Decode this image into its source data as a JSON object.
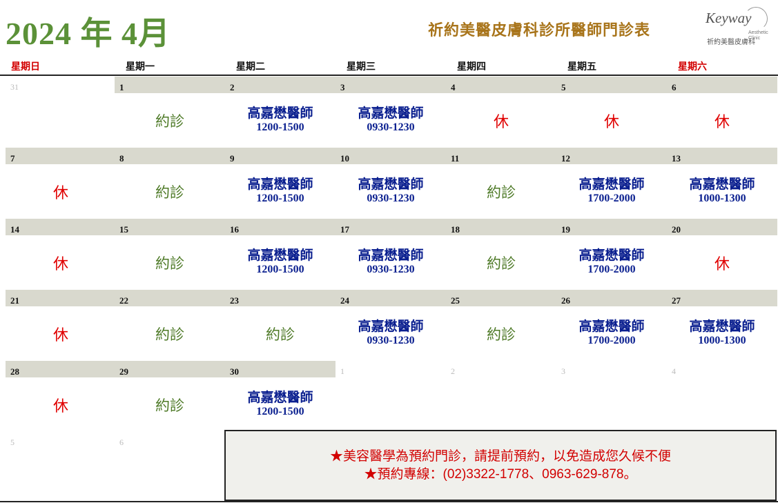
{
  "header": {
    "month_title": "2024 年 4月",
    "clinic_title": "祈約美醫皮膚科診所醫師門診表",
    "logo_script": "Keyway",
    "logo_sub": "祈約美醫皮膚科",
    "logo_aesthetic": "Aesthetic",
    "logo_clinic": "Clinic"
  },
  "weekdays": [
    {
      "label": "星期日",
      "color": "#d20000"
    },
    {
      "label": "星期一",
      "color": "#111111"
    },
    {
      "label": "星期二",
      "color": "#111111"
    },
    {
      "label": "星期三",
      "color": "#111111"
    },
    {
      "label": "星期四",
      "color": "#111111"
    },
    {
      "label": "星期五",
      "color": "#111111"
    },
    {
      "label": "星期六",
      "color": "#d20000"
    }
  ],
  "weeks": [
    [
      {
        "day": "31",
        "other": true
      },
      {
        "day": "1",
        "type": "appt",
        "text": "約診"
      },
      {
        "day": "2",
        "type": "doctor",
        "doctor": "高嘉懋醫師",
        "time": "1200-1500"
      },
      {
        "day": "3",
        "type": "doctor",
        "doctor": "高嘉懋醫師",
        "time": "0930-1230"
      },
      {
        "day": "4",
        "type": "rest",
        "text": "休"
      },
      {
        "day": "5",
        "type": "rest",
        "text": "休"
      },
      {
        "day": "6",
        "type": "rest",
        "text": "休"
      }
    ],
    [
      {
        "day": "7",
        "type": "rest",
        "text": "休"
      },
      {
        "day": "8",
        "type": "appt",
        "text": "約診"
      },
      {
        "day": "9",
        "type": "doctor",
        "doctor": "高嘉懋醫師",
        "time": "1200-1500"
      },
      {
        "day": "10",
        "type": "doctor",
        "doctor": "高嘉懋醫師",
        "time": "0930-1230"
      },
      {
        "day": "11",
        "type": "appt",
        "text": "約診"
      },
      {
        "day": "12",
        "type": "doctor",
        "doctor": "高嘉懋醫師",
        "time": "1700-2000"
      },
      {
        "day": "13",
        "type": "doctor",
        "doctor": "高嘉懋醫師",
        "time": "1000-1300"
      }
    ],
    [
      {
        "day": "14",
        "type": "rest",
        "text": "休"
      },
      {
        "day": "15",
        "type": "appt",
        "text": "約診"
      },
      {
        "day": "16",
        "type": "doctor",
        "doctor": "高嘉懋醫師",
        "time": "1200-1500"
      },
      {
        "day": "17",
        "type": "doctor",
        "doctor": "高嘉懋醫師",
        "time": "0930-1230"
      },
      {
        "day": "18",
        "type": "appt",
        "text": "約診"
      },
      {
        "day": "19",
        "type": "doctor",
        "doctor": "高嘉懋醫師",
        "time": "1700-2000"
      },
      {
        "day": "20",
        "type": "rest",
        "text": "休"
      }
    ],
    [
      {
        "day": "21",
        "type": "rest",
        "text": "休"
      },
      {
        "day": "22",
        "type": "appt",
        "text": "約診"
      },
      {
        "day": "23",
        "type": "appt",
        "text": "約診"
      },
      {
        "day": "24",
        "type": "doctor",
        "doctor": "高嘉懋醫師",
        "time": "0930-1230"
      },
      {
        "day": "25",
        "type": "appt",
        "text": "約診"
      },
      {
        "day": "26",
        "type": "doctor",
        "doctor": "高嘉懋醫師",
        "time": "1700-2000"
      },
      {
        "day": "27",
        "type": "doctor",
        "doctor": "高嘉懋醫師",
        "time": "1000-1300"
      }
    ],
    [
      {
        "day": "28",
        "type": "rest",
        "text": "休"
      },
      {
        "day": "29",
        "type": "appt",
        "text": "約診"
      },
      {
        "day": "30",
        "type": "doctor",
        "doctor": "高嘉懋醫師",
        "time": "1200-1500"
      },
      {
        "day": "1",
        "other": true
      },
      {
        "day": "2",
        "other": true
      },
      {
        "day": "3",
        "other": true
      },
      {
        "day": "4",
        "other": true
      }
    ],
    [
      {
        "day": "5",
        "other": true
      },
      {
        "day": "6",
        "other": true
      }
    ]
  ],
  "notice": {
    "line1": "★美容醫學為預約門診，請提前預約，以免造成您久候不便",
    "line2": "★預約專線：(02)3322-1778、0963-629-878。"
  },
  "colors": {
    "title_green": "#5b9138",
    "clinic_gold": "#a8741a",
    "rest_red": "#e00000",
    "appt_green": "#4e7a27",
    "doctor_blue": "#0a1f8f",
    "day_header_bg": "#d9d9ce"
  }
}
